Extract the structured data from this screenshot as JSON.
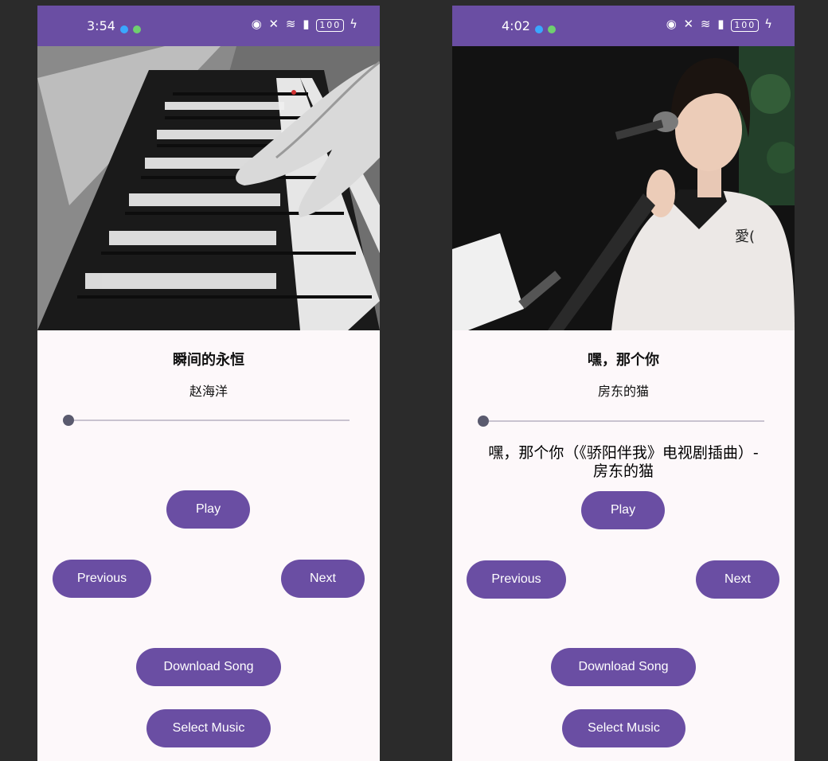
{
  "left": {
    "status": {
      "time": "3:54",
      "battery": "100"
    },
    "title": "瞬间的永恒",
    "artist": "赵海洋",
    "lyric_line1": "",
    "lyric_line2": "",
    "buttons": {
      "play": "Play",
      "previous": "Previous",
      "next": "Next",
      "download": "Download Song",
      "select": "Select Music"
    }
  },
  "right": {
    "status": {
      "time": "4:02",
      "battery": "100"
    },
    "title": "嘿，那个你",
    "artist": "房东的猫",
    "lyric_line1": "嘿，那个你（《骄阳伴我》电视剧插曲）-",
    "lyric_line2": "房东的猫",
    "buttons": {
      "play": "Play",
      "previous": "Previous",
      "next": "Next",
      "download": "Download Song",
      "select": "Select Music"
    }
  },
  "seek": {
    "left_progress": 0,
    "right_progress": 0
  },
  "colors": {
    "accent": "#6a4ea3",
    "background": "#fdf8fa",
    "frame": "#2b2b2b"
  }
}
